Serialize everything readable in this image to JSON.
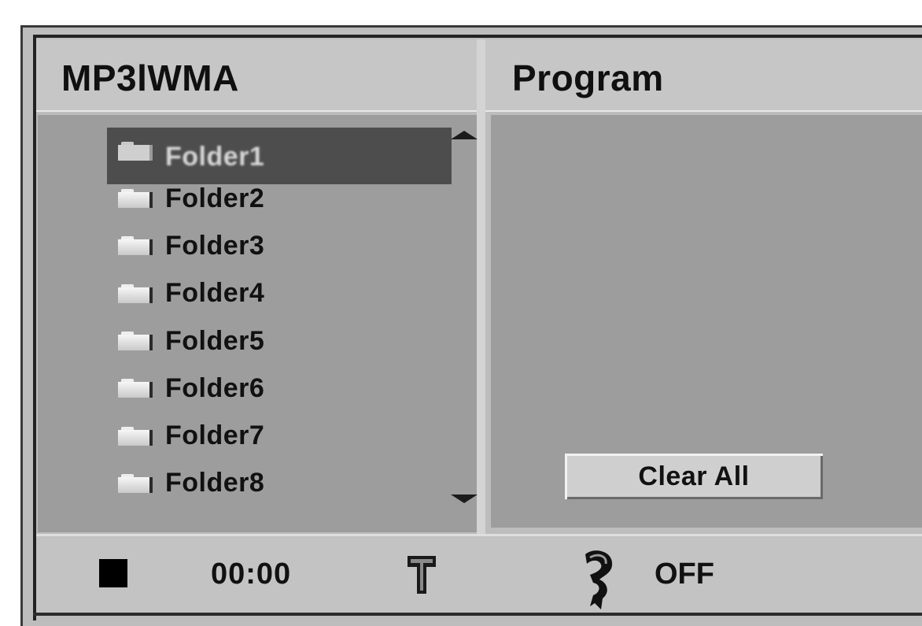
{
  "left_panel": {
    "title": "MP3lWMA"
  },
  "right_panel": {
    "title": "Program"
  },
  "folders": [
    {
      "label": "Folder1",
      "selected": true
    },
    {
      "label": "Folder2",
      "selected": false
    },
    {
      "label": "Folder3",
      "selected": false
    },
    {
      "label": "Folder4",
      "selected": false
    },
    {
      "label": "Folder5",
      "selected": false
    },
    {
      "label": "Folder6",
      "selected": false
    },
    {
      "label": "Folder7",
      "selected": false
    },
    {
      "label": "Folder8",
      "selected": false
    }
  ],
  "icons": {
    "folder": "folder-icon",
    "scroll_up": "scroll-up-arrow-icon",
    "scroll_down": "scroll-down-arrow-icon",
    "stop": "stop-icon",
    "title": "title-icon",
    "repeat": "repeat-icon"
  },
  "buttons": {
    "clear_all": "Clear All"
  },
  "status": {
    "time": "00:00",
    "repeat_state": "OFF"
  },
  "colors": {
    "panel_bg": "#9d9d9d",
    "header_bg": "#c6c6c6",
    "selected_row": "#4d4d4d",
    "status_bg": "#c3c3c3"
  }
}
